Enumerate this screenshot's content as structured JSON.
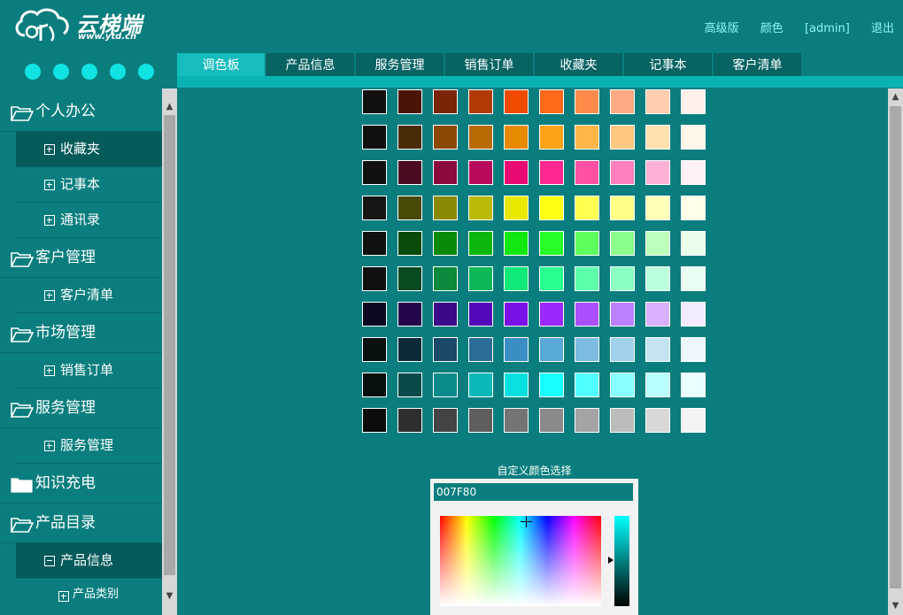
{
  "header": {
    "logo_text": "云梯端",
    "logo_url": "www.ytd.cn",
    "links": [
      "高级版",
      "颜色",
      "[admin]",
      "退出"
    ]
  },
  "tabs": [
    "调色板",
    "产品信息",
    "服务管理",
    "销售订单",
    "收藏夹",
    "记事本",
    "客户清单"
  ],
  "sidebar": [
    {
      "level": 1,
      "label": "个人办公"
    },
    {
      "level": 2,
      "label": "收藏夹",
      "state": "plus",
      "active": true
    },
    {
      "level": 2,
      "label": "记事本",
      "state": "plus"
    },
    {
      "level": 2,
      "label": "通讯录",
      "state": "plus"
    },
    {
      "level": 1,
      "label": "客户管理"
    },
    {
      "level": 2,
      "label": "客户清单",
      "state": "plus"
    },
    {
      "level": 1,
      "label": "市场管理"
    },
    {
      "level": 2,
      "label": "销售订单",
      "state": "plus"
    },
    {
      "level": 1,
      "label": "服务管理"
    },
    {
      "level": 2,
      "label": "服务管理",
      "state": "plus"
    },
    {
      "level": 1,
      "label": "知识充电"
    },
    {
      "level": 1,
      "label": "产品目录"
    },
    {
      "level": 2,
      "label": "产品信息",
      "state": "minus",
      "active": true
    },
    {
      "level": 3,
      "label": "产品类别"
    }
  ],
  "palette": [
    [
      "#111111",
      "#4a1408",
      "#7a2408",
      "#b23a06",
      "#f04b00",
      "#ff6a1a",
      "#ff8b4a",
      "#ffaa80",
      "#ffcdb0",
      "#fff0ea"
    ],
    [
      "#111111",
      "#4a2c08",
      "#8a4a05",
      "#b86a05",
      "#e88a00",
      "#ffa216",
      "#ffb648",
      "#ffc880",
      "#ffe0b0",
      "#fff6ea"
    ],
    [
      "#111111",
      "#4a0a22",
      "#8a0a40",
      "#b80a5a",
      "#ea0a74",
      "#ff2890",
      "#ff50a4",
      "#ff80bc",
      "#ffb0d6",
      "#fff0f6"
    ],
    [
      "#161616",
      "#4a4a08",
      "#8a8a08",
      "#baba08",
      "#e8e800",
      "#ffff10",
      "#ffff50",
      "#ffff88",
      "#ffffb8",
      "#ffffea"
    ],
    [
      "#111111",
      "#0a4a0a",
      "#0a8a0a",
      "#0ab80a",
      "#10e810",
      "#28ff28",
      "#5cff5c",
      "#8cff8c",
      "#bcffbc",
      "#eaffea"
    ],
    [
      "#111111",
      "#0a4a20",
      "#0a8a3a",
      "#0ab858",
      "#10e878",
      "#28ff90",
      "#5cffaa",
      "#8cffc4",
      "#bcffdc",
      "#eafff4"
    ],
    [
      "#0c0822",
      "#22084a",
      "#3a0a8a",
      "#5208b8",
      "#7a10e8",
      "#9a28ff",
      "#aa50ff",
      "#bc80ff",
      "#d8b0ff",
      "#f4eaff"
    ],
    [
      "#081010",
      "#0a2a3a",
      "#1a4a68",
      "#2a6e98",
      "#3a8ec4",
      "#58a8d8",
      "#7cbce0",
      "#a0d0ea",
      "#c4e4f4",
      "#eef8fc"
    ],
    [
      "#081010",
      "#0a4a4a",
      "#0a8a8a",
      "#0ab8b8",
      "#08e0e0",
      "#18ffff",
      "#50ffff",
      "#88ffff",
      "#b8ffff",
      "#eaffff"
    ],
    [
      "#0c0c0c",
      "#2e2e2e",
      "#444444",
      "#5e5e5e",
      "#747474",
      "#8a8a8a",
      "#a4a4a4",
      "#bcbcbc",
      "#d8d8d8",
      "#f4f4f4"
    ]
  ],
  "custom": {
    "title": "自定义颜色选择",
    "hex_value": "007F80"
  }
}
